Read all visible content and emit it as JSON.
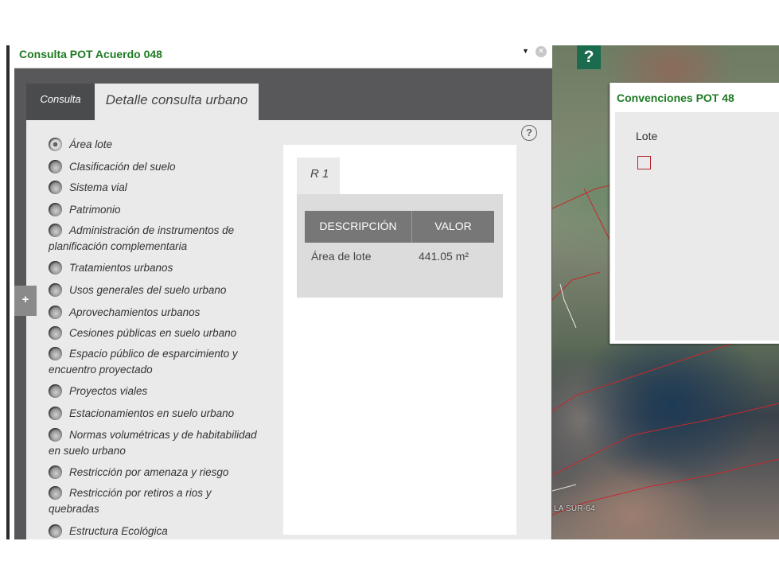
{
  "panel": {
    "title": "Consulta POT Acuerdo 048",
    "tabs": [
      {
        "label": "Consulta"
      },
      {
        "label": "Detalle consulta urbano"
      }
    ],
    "help_symbol": "?",
    "options": [
      {
        "label": "Área lote",
        "selected": true
      },
      {
        "label": "Clasificación del suelo"
      },
      {
        "label": "Sistema vial"
      },
      {
        "label": "Patrimonio"
      },
      {
        "label": "Administración de instrumentos de planificación complementaria"
      },
      {
        "label": "Tratamientos urbanos"
      },
      {
        "label": "Usos generales del suelo urbano"
      },
      {
        "label": "Aprovechamientos urbanos"
      },
      {
        "label": "Cesiones públicas en suelo urbano"
      },
      {
        "label": "Espacio público de esparcimiento y encuentro proyectado"
      },
      {
        "label": "Proyectos viales"
      },
      {
        "label": "Estacionamientos en suelo urbano"
      },
      {
        "label": "Normas volumétricas y de habitabilidad en suelo urbano"
      },
      {
        "label": "Restricción por amenaza y riesgo"
      },
      {
        "label": "Restricción por retiros a rios y quebradas"
      },
      {
        "label": "Estructura Ecológica"
      }
    ],
    "result": {
      "tab": "R 1",
      "columns": [
        "DESCRIPCIÓN",
        "VALOR"
      ],
      "rows": [
        {
          "descripcion": "Área de lote",
          "valor": "441.05 m²"
        }
      ]
    },
    "expand_symbol": "+"
  },
  "map": {
    "help_symbol": "?",
    "street_label": "LA SUR-64",
    "legend": {
      "title": "Convenciones POT 48",
      "item_label": "Lote",
      "item_color": "#b3262a"
    }
  },
  "colors": {
    "accent_green": "#1e7a22",
    "panel_dark": "#58585a",
    "map_button": "#1b6b4e"
  }
}
